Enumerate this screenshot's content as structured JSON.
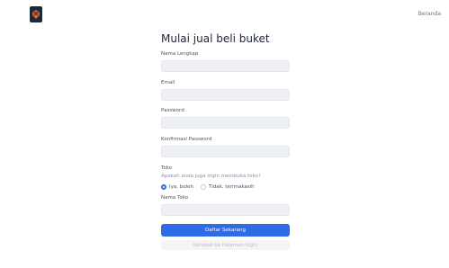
{
  "header": {
    "nav_link": "Beranda",
    "logo_icon": "store-logo-icon"
  },
  "form": {
    "title": "Mulai jual beli buket",
    "fields": {
      "name_label": "Nama Lengkap",
      "email_label": "Email",
      "password_label": "Password",
      "confirm_label": "Konfirmasi Password"
    },
    "store": {
      "section_label": "Toko",
      "question": "Apakah anda juga ingin membuka toko?",
      "option_yes": "Iya, boleh",
      "option_no": "Tidak, terimakasih",
      "selected": "Iya, boleh",
      "store_name_label": "Nama Toko"
    },
    "submit_label": "Daftar Sekarang",
    "back_label": "Kembali ke halaman login"
  },
  "colors": {
    "primary": "#2e6be6",
    "logo_bg": "#1b2a3a",
    "logo_accent": "#e8642c"
  }
}
